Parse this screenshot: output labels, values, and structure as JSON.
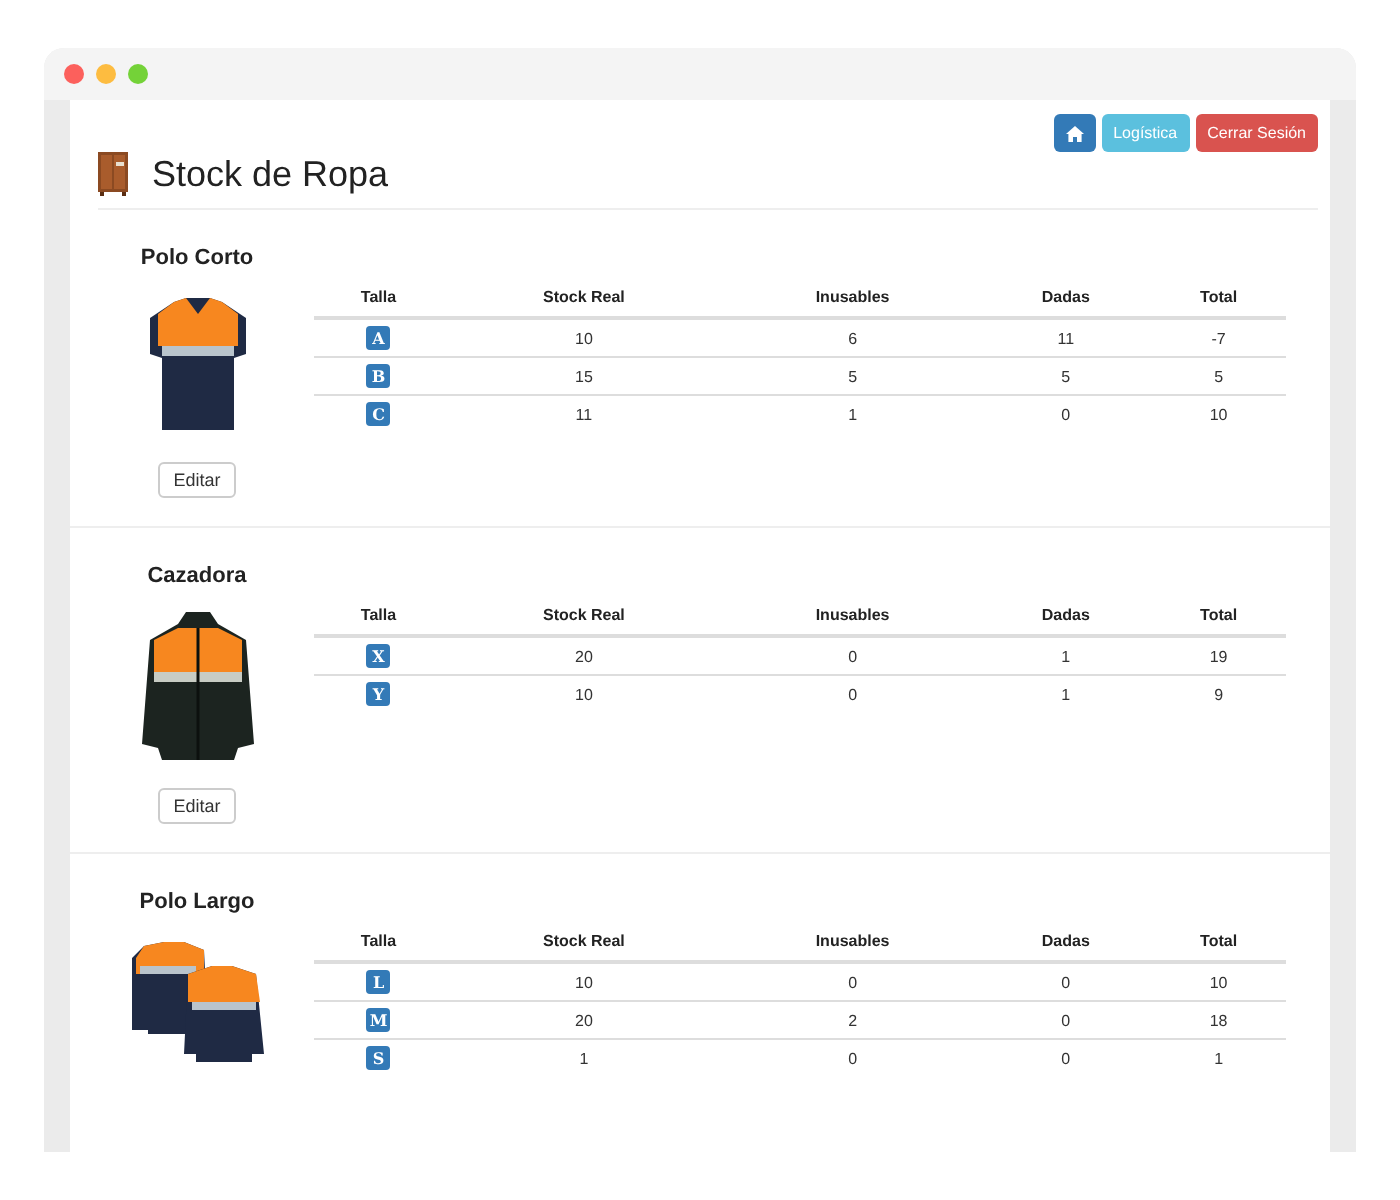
{
  "header": {
    "title": "Stock de Ropa"
  },
  "nav_buttons": [
    {
      "kind": "home"
    },
    {
      "kind": "info",
      "label": "Logística"
    },
    {
      "kind": "danger",
      "label": "Cerrar Sesión"
    }
  ],
  "products": [
    {
      "name": "Polo Corto",
      "kind": "short-polo",
      "edit_button": "Editar",
      "columns": [
        "Talla",
        "Stock Real",
        "Inusables",
        "Dadas",
        "Total"
      ],
      "rows": [
        {
          "size": "A",
          "stock": "10",
          "unusable": "6",
          "given": "11",
          "total": "-7"
        },
        {
          "size": "B",
          "stock": "15",
          "unusable": "5",
          "given": "5",
          "total": "5"
        },
        {
          "size": "C",
          "stock": "11",
          "unusable": "1",
          "given": "0",
          "total": "10"
        }
      ]
    },
    {
      "name": "Cazadora",
      "kind": "jacket",
      "edit_button": "Editar",
      "columns": [
        "Talla",
        "Stock Real",
        "Inusables",
        "Dadas",
        "Total"
      ],
      "rows": [
        {
          "size": "X",
          "stock": "20",
          "unusable": "0",
          "given": "1",
          "total": "19"
        },
        {
          "size": "Y",
          "stock": "10",
          "unusable": "0",
          "given": "1",
          "total": "9"
        }
      ]
    },
    {
      "name": "Polo Largo",
      "kind": "long-polo",
      "columns": [
        "Talla",
        "Stock Real",
        "Inusables",
        "Dadas",
        "Total"
      ],
      "rows": [
        {
          "size": "L",
          "stock": "10",
          "unusable": "0",
          "given": "0",
          "total": "10"
        },
        {
          "size": "M",
          "stock": "20",
          "unusable": "2",
          "given": "0",
          "total": "18"
        },
        {
          "size": "S",
          "stock": "1",
          "unusable": "0",
          "given": "0",
          "total": "1"
        }
      ]
    }
  ]
}
